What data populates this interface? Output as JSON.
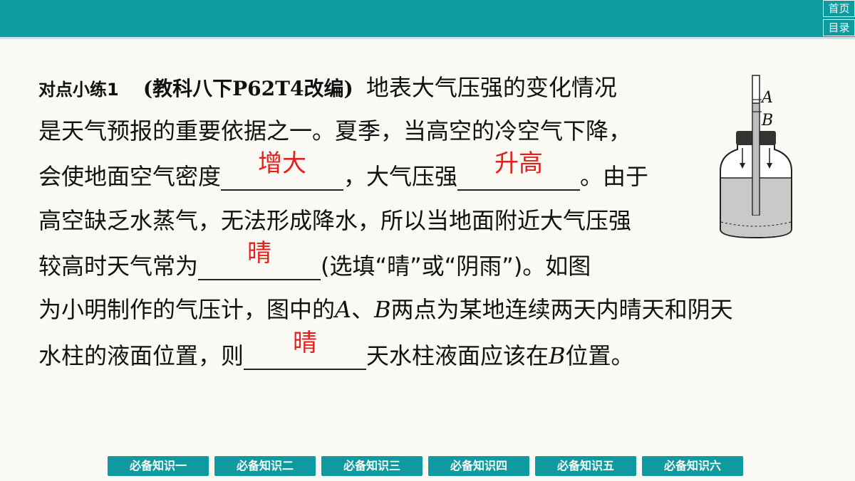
{
  "header": {
    "home_label": "首页",
    "toc_label": "目录"
  },
  "question": {
    "label": "对点小练1",
    "source": "(教科八下P62T4改编)",
    "lines": {
      "l1": "地表大气压强的变化情况",
      "l2": "是天气预报的重要依据之一。夏季，当高空的冷空气下降，",
      "l3a": "会使地面空气密度",
      "l3b": "，大气压强",
      "l3c": "。由于",
      "l4": "高空缺乏水蒸气，无法形成降水，所以当地面附近大气压强",
      "l5a": "较高时天气常为",
      "l5b": "(选填“晴”或“阴雨”)。如图",
      "l6a": "为小明制作的气压计，图中的",
      "l6A": "A",
      "l6b": "、",
      "l6B": "B",
      "l6c": "两点为某地连续两天内晴天和阴天",
      "l7a": "水柱的液面位置，则",
      "l7b": "天水柱液面应该在",
      "l7B": "B",
      "l7c": "位置。"
    },
    "answers": {
      "a1": "增大",
      "a2": "升高",
      "a3": "晴",
      "a4": "晴"
    }
  },
  "diagram": {
    "label_a": "A",
    "label_b": "B"
  },
  "nav": [
    "必备知识一",
    "必备知识二",
    "必备知识三",
    "必备知识四",
    "必备知识五",
    "必备知识六"
  ],
  "colors": {
    "accent": "#0e9a9e",
    "answer": "#e3201b"
  }
}
